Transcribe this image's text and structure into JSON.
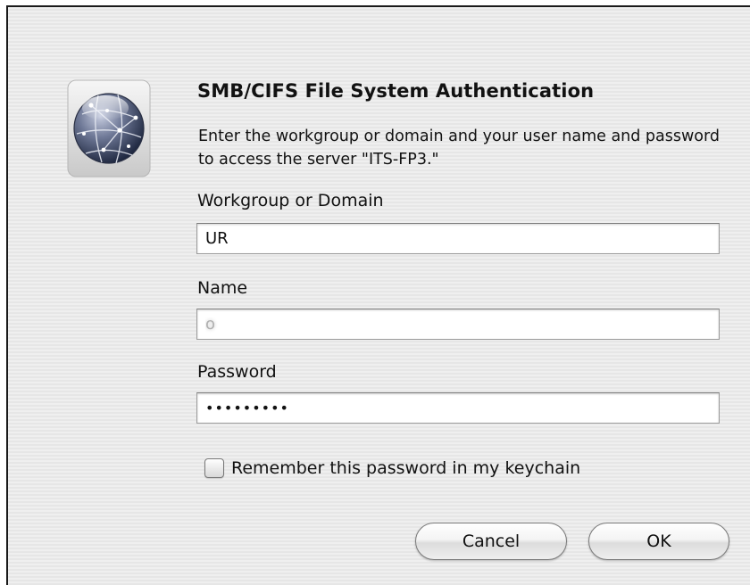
{
  "dialog": {
    "title": "SMB/CIFS File System Authentication",
    "message": "Enter the workgroup or domain and your user name and password to access the server \"ITS-FP3.\"",
    "icon": "network-globe-icon"
  },
  "fields": {
    "workgroup": {
      "label": "Workgroup or Domain",
      "value": "UR"
    },
    "name": {
      "label": "Name",
      "value": "o"
    },
    "password": {
      "label": "Password",
      "value": "•••••••••"
    }
  },
  "remember": {
    "label": "Remember this password in my keychain",
    "checked": false
  },
  "buttons": {
    "cancel": "Cancel",
    "ok": "OK"
  }
}
